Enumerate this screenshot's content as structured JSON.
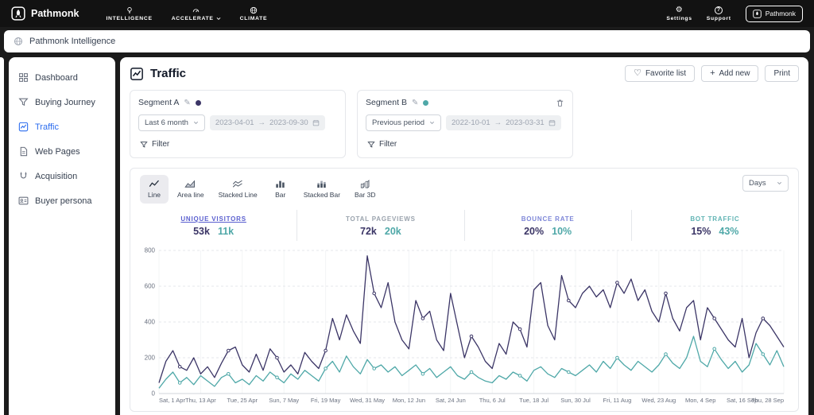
{
  "topbar": {
    "brand": "Pathmonk",
    "nav": [
      {
        "label": "INTELLIGENCE"
      },
      {
        "label": "ACCELERATE",
        "has_chevron": true
      },
      {
        "label": "CLIMATE"
      }
    ],
    "settings_label": "Settings",
    "support_label": "Support",
    "account_button": "Pathmonk"
  },
  "app_header": {
    "title": "Pathmonk Intelligence"
  },
  "sidebar": {
    "items": [
      {
        "label": "Dashboard",
        "active": false
      },
      {
        "label": "Buying Journey",
        "active": false
      },
      {
        "label": "Traffic",
        "active": true
      },
      {
        "label": "Web Pages",
        "active": false
      },
      {
        "label": "Acquisition",
        "active": false
      },
      {
        "label": "Buyer persona",
        "active": false
      }
    ]
  },
  "page": {
    "title": "Traffic",
    "actions": [
      "Favorite list",
      "Add new",
      "Print"
    ]
  },
  "segments": {
    "a": {
      "name": "Segment A",
      "color": "#3b3566",
      "preset": "Last 6 month",
      "start": "2023-04-01",
      "end": "2023-09-30",
      "filter_label": "Filter"
    },
    "b": {
      "name": "Segment B",
      "color": "#4fa8a8",
      "preset": "Previous period",
      "start": "2022-10-01",
      "end": "2023-03-31",
      "filter_label": "Filter"
    }
  },
  "chart_controls": {
    "types": [
      "Line",
      "Area line",
      "Stacked Line",
      "Bar",
      "Stacked Bar",
      "Bar 3D"
    ],
    "active": "Line",
    "interval": "Days"
  },
  "stats": [
    {
      "label": "UNIQUE VISITORS",
      "a": "53k",
      "b": "11k",
      "label_color": "#5a5fcf"
    },
    {
      "label": "TOTAL PAGEVIEWS",
      "a": "72k",
      "b": "20k",
      "label_color": "#9aa3ad"
    },
    {
      "label": "BOUNCE RATE",
      "a": "20%",
      "b": "10%",
      "label_color": "#7e87d8"
    },
    {
      "label": "BOT TRAFFIC",
      "a": "15%",
      "b": "43%",
      "label_color": "#5fb3b3"
    }
  ],
  "chart_data": {
    "type": "line",
    "title": "Traffic",
    "xlabel": "",
    "ylabel": "",
    "ylim": [
      0,
      800
    ],
    "yticks": [
      0,
      200,
      400,
      600,
      800
    ],
    "grid": true,
    "x_tick_labels": [
      "Sat, 1 Apr",
      "Thu, 13 Apr",
      "Tue, 25 Apr",
      "Sun, 7 May",
      "Fri, 19 May",
      "Wed, 31 May",
      "Mon, 12 Jun",
      "Sat, 24 Jun",
      "Thu, 6 Jul",
      "Tue, 18 Jul",
      "Sun, 30 Jul",
      "Fri, 11 Aug",
      "Wed, 23 Aug",
      "Mon, 4 Sep",
      "Sat, 16 Sep",
      "Thu, 28 Sep"
    ],
    "series": [
      {
        "name": "Segment A",
        "color": "#3b3566",
        "values": [
          60,
          180,
          240,
          150,
          130,
          200,
          110,
          150,
          90,
          170,
          240,
          260,
          160,
          120,
          220,
          130,
          250,
          200,
          120,
          160,
          110,
          230,
          180,
          140,
          240,
          420,
          300,
          440,
          350,
          280,
          770,
          560,
          480,
          620,
          400,
          300,
          250,
          520,
          420,
          460,
          300,
          240,
          560,
          380,
          200,
          320,
          260,
          180,
          140,
          280,
          220,
          400,
          360,
          260,
          580,
          620,
          380,
          300,
          660,
          520,
          480,
          560,
          600,
          540,
          580,
          480,
          620,
          560,
          640,
          520,
          580,
          460,
          400,
          560,
          420,
          350,
          480,
          520,
          300,
          480,
          420,
          360,
          300,
          260,
          420,
          200,
          340,
          420,
          380,
          320,
          260
        ]
      },
      {
        "name": "Segment B",
        "color": "#4fa8a8",
        "values": [
          30,
          80,
          120,
          60,
          90,
          50,
          100,
          70,
          40,
          90,
          110,
          60,
          80,
          50,
          100,
          70,
          120,
          90,
          60,
          110,
          80,
          130,
          100,
          70,
          140,
          180,
          120,
          210,
          150,
          110,
          190,
          140,
          160,
          120,
          150,
          100,
          130,
          160,
          110,
          140,
          90,
          120,
          150,
          100,
          80,
          120,
          90,
          70,
          60,
          100,
          80,
          120,
          100,
          70,
          130,
          150,
          110,
          90,
          140,
          120,
          100,
          130,
          160,
          120,
          180,
          140,
          200,
          160,
          130,
          180,
          150,
          120,
          160,
          220,
          170,
          140,
          200,
          320,
          180,
          150,
          250,
          190,
          140,
          180,
          120,
          160,
          280,
          220,
          160,
          240,
          150
        ]
      }
    ]
  }
}
